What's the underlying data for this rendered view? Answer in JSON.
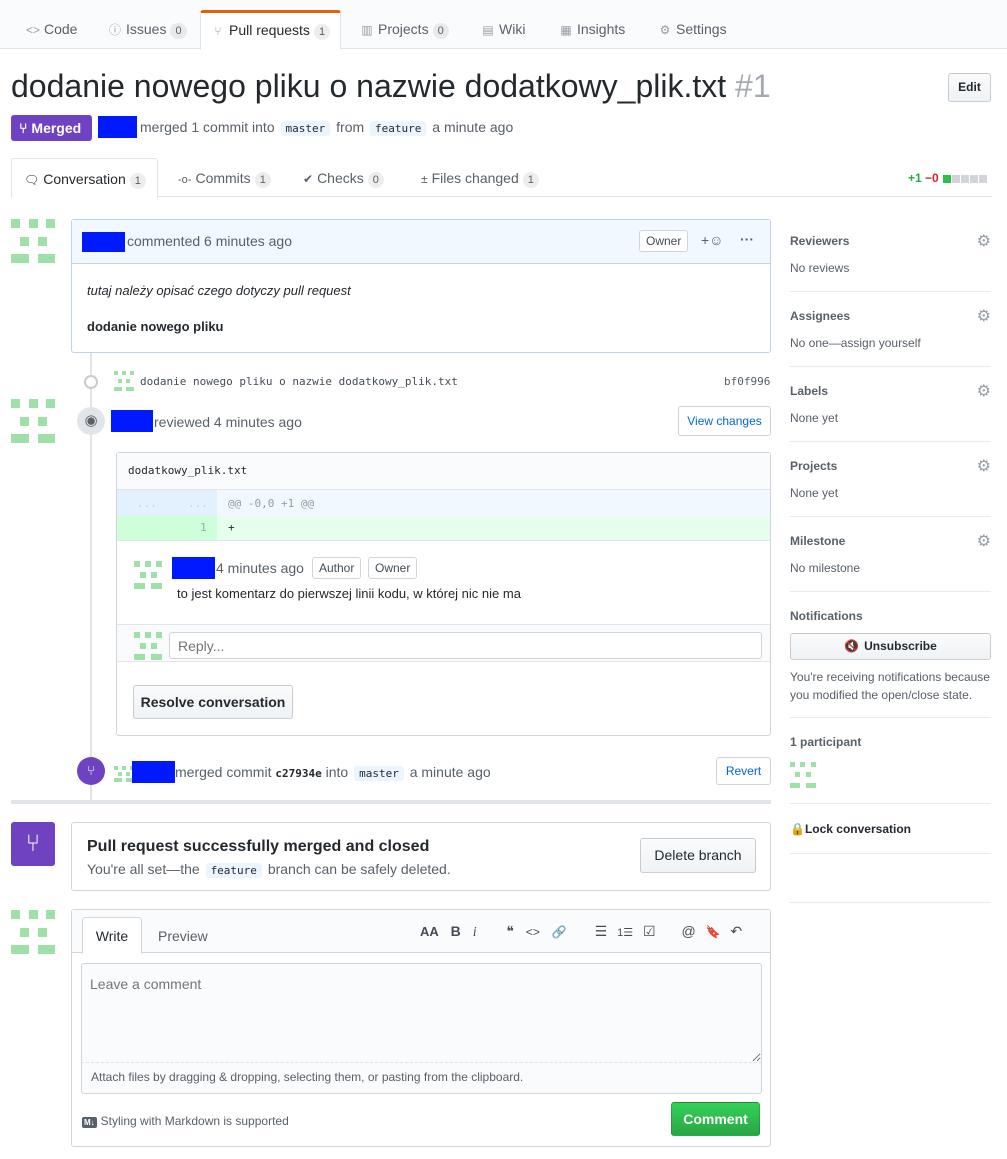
{
  "repo_nav": {
    "tabs": [
      {
        "label": "Code",
        "icon": "code-icon",
        "glyph": "<>"
      },
      {
        "label": "Issues",
        "count": "0",
        "icon": "issue-icon",
        "glyph": "ⓘ"
      },
      {
        "label": "Pull requests",
        "count": "1",
        "icon": "pr-icon",
        "glyph": "⑂"
      },
      {
        "label": "Projects",
        "count": "0",
        "icon": "project-icon",
        "glyph": "▥"
      },
      {
        "label": "Wiki",
        "icon": "book-icon",
        "glyph": "▤"
      },
      {
        "label": "Insights",
        "icon": "graph-icon",
        "glyph": "▦"
      },
      {
        "label": "Settings",
        "icon": "gear-icon",
        "glyph": "⚙"
      }
    ]
  },
  "header": {
    "title": "dodanie nowego pliku o nazwie dodatkowy_plik.txt",
    "number": "#1",
    "edit_label": "Edit",
    "state_label": "Merged",
    "meta_merged": "merged 1 commit into",
    "base_branch": "master",
    "meta_from": "from",
    "head_branch": "feature",
    "meta_time": "a minute ago"
  },
  "pr_tabs": [
    {
      "label": "Conversation",
      "count": "1",
      "glyph": "🗨"
    },
    {
      "label": "Commits",
      "count": "1",
      "glyph": "-o-"
    },
    {
      "label": "Checks",
      "count": "0",
      "glyph": "✔"
    },
    {
      "label": "Files changed",
      "count": "1",
      "glyph": "±"
    }
  ],
  "diffstat": {
    "additions": "+1",
    "deletions": "−0"
  },
  "opening_comment": {
    "header": "commented 6 minutes ago",
    "owner_label": "Owner",
    "reaction": "+☺",
    "more": "···",
    "body_italic": "tutaj należy opisać czego dotyczy pull request",
    "body_bold": "dodanie nowego pliku"
  },
  "commit_event": {
    "message": "dodanie nowego pliku o nazwie dodatkowy_plik.txt",
    "sha": "bf0f996"
  },
  "review": {
    "header": "reviewed 4 minutes ago",
    "view_changes": "View changes",
    "file": "dodatkowy_plik.txt",
    "hunk_left": "...",
    "hunk_right": "...",
    "hunk_header": "@@ -0,0 +1 @@",
    "line_number": "1",
    "line_code": "+",
    "comment_time": "4 minutes ago",
    "author_label": "Author",
    "owner_label": "Owner",
    "comment_body": "to jest komentarz do pierwszej linii kodu, w której nic nie ma",
    "reply_placeholder": "Reply...",
    "resolve_label": "Resolve conversation"
  },
  "merge_event": {
    "merged_text": "merged commit",
    "sha": "c27934e",
    "into": "into",
    "branch": "master",
    "time": "a minute ago",
    "revert_label": "Revert"
  },
  "merge_box": {
    "title": "Pull request successfully merged and closed",
    "text_before": "You're all set—the",
    "branch": "feature",
    "text_after": "branch can be safely deleted.",
    "delete_label": "Delete branch"
  },
  "composer": {
    "write_tab": "Write",
    "preview_tab": "Preview",
    "toolbar": [
      "AA",
      "B",
      "i",
      "❝",
      "<>",
      "🔗",
      "☰",
      "1☰",
      "☑",
      "@",
      "🔖",
      "↶"
    ],
    "placeholder": "Leave a comment",
    "attach_text": "Attach files by dragging & dropping, selecting them, or pasting from the clipboard.",
    "markdown_badge": "M↓",
    "markdown_note": "Styling with Markdown is supported",
    "submit_label": "Comment"
  },
  "sidebar": {
    "reviewers": {
      "title": "Reviewers",
      "value": "No reviews"
    },
    "assignees": {
      "title": "Assignees",
      "value": "No one—assign yourself"
    },
    "labels": {
      "title": "Labels",
      "value": "None yet"
    },
    "projects": {
      "title": "Projects",
      "value": "None yet"
    },
    "milestone": {
      "title": "Milestone",
      "value": "No milestone"
    },
    "notifications": {
      "title": "Notifications",
      "button": "Unsubscribe",
      "note": "You're receiving notifications because you modified the open/close state."
    },
    "participants": "1 participant",
    "lock": "Lock conversation"
  },
  "colors": {
    "merged_purple": "#6f42c1",
    "comment_green": "#28a745",
    "redaction_blue": "#0019ff",
    "diff_add_bg": "#e6ffed",
    "hunk_bg": "#f1f8ff"
  }
}
